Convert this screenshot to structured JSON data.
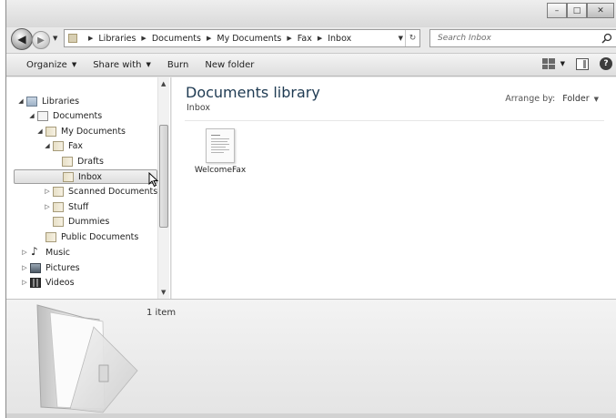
{
  "window": {
    "caption_buttons": [
      "minimize-icon",
      "maximize-icon",
      "close-icon"
    ]
  },
  "address": {
    "breadcrumbs": [
      "Libraries",
      "Documents",
      "My Documents",
      "Fax",
      "Inbox"
    ]
  },
  "search": {
    "placeholder": "Search Inbox"
  },
  "toolbar": {
    "organize": "Organize",
    "share_with": "Share with",
    "burn": "Burn",
    "new_folder": "New folder"
  },
  "nav_tree": [
    {
      "label": "Libraries",
      "icon": "libraries-icon",
      "expander": "expanded"
    },
    {
      "label": "Documents",
      "icon": "documents-library-icon",
      "expander": "expanded"
    },
    {
      "label": "My Documents",
      "icon": "folder-icon",
      "expander": "expanded"
    },
    {
      "label": "Fax",
      "icon": "folder-icon",
      "expander": "expanded"
    },
    {
      "label": "Drafts",
      "icon": "folder-icon",
      "expander": "none"
    },
    {
      "label": "Inbox",
      "icon": "folder-icon",
      "expander": "none",
      "selected": true
    },
    {
      "label": "Scanned Documents",
      "icon": "folder-icon",
      "expander": "collapsed"
    },
    {
      "label": "Stuff",
      "icon": "folder-icon",
      "expander": "collapsed"
    },
    {
      "label": "Dummies",
      "icon": "folder-icon",
      "expander": "none"
    },
    {
      "label": "Public Documents",
      "icon": "folder-icon",
      "expander": "none"
    },
    {
      "label": "Music",
      "icon": "music-icon",
      "expander": "collapsed"
    },
    {
      "label": "Pictures",
      "icon": "pictures-icon",
      "expander": "collapsed"
    },
    {
      "label": "Videos",
      "icon": "videos-icon",
      "expander": "collapsed"
    }
  ],
  "content": {
    "title": "Documents library",
    "subtitle": "Inbox",
    "arrange_label": "Arrange by:",
    "arrange_value": "Folder",
    "files": [
      {
        "name": "WelcomeFax",
        "icon": "fax-document-icon"
      }
    ]
  },
  "details": {
    "count": "1 item"
  },
  "colors": {
    "title_blue": "#1e3a52",
    "chrome_gray": "#e9e9e9",
    "selection_gray": "#dedede"
  }
}
